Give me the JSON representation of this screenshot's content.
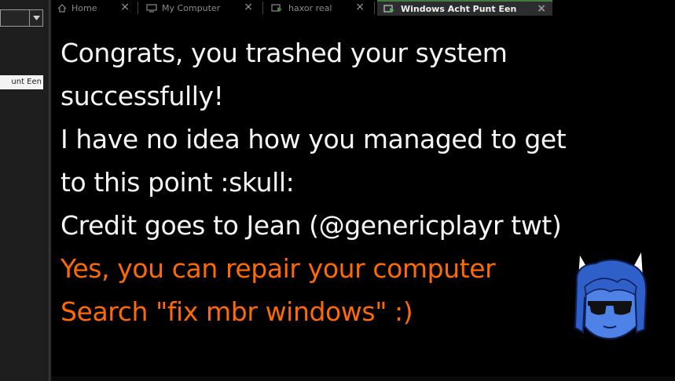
{
  "sidebar": {
    "dropdown_value": "",
    "vm_item_label": "unt Een"
  },
  "tabs": [
    {
      "label": "Home",
      "icon": "home-icon",
      "active": false
    },
    {
      "label": "My Computer",
      "icon": "computer-icon",
      "active": false
    },
    {
      "label": "haxor real",
      "icon": "vm-icon",
      "active": false
    },
    {
      "label": "Windows Acht Punt Een",
      "icon": "vm-icon",
      "active": true
    }
  ],
  "console": {
    "lines": [
      {
        "text": "Congrats, you trashed your system",
        "color": "#f5f5f5"
      },
      {
        "text": "successfully!",
        "color": "#f5f5f5"
      },
      {
        "text": "I have no idea how you managed to get",
        "color": "#f5f5f5"
      },
      {
        "text": "to this point :skull:",
        "color": "#f5f5f5"
      },
      {
        "text": "Credit goes to Jean (@genericplayr twt)",
        "color": "#f5f5f5"
      },
      {
        "text": "Yes, you can repair your computer",
        "color": "#ff6a00"
      },
      {
        "text": "Search \"fix mbr windows\" :)",
        "color": "#ff6a00"
      }
    ]
  },
  "colors": {
    "background": "#000000",
    "text_primary": "#f5f5f5",
    "text_accent": "#ff6a00",
    "avatar_blue": "#3b6fd6"
  }
}
